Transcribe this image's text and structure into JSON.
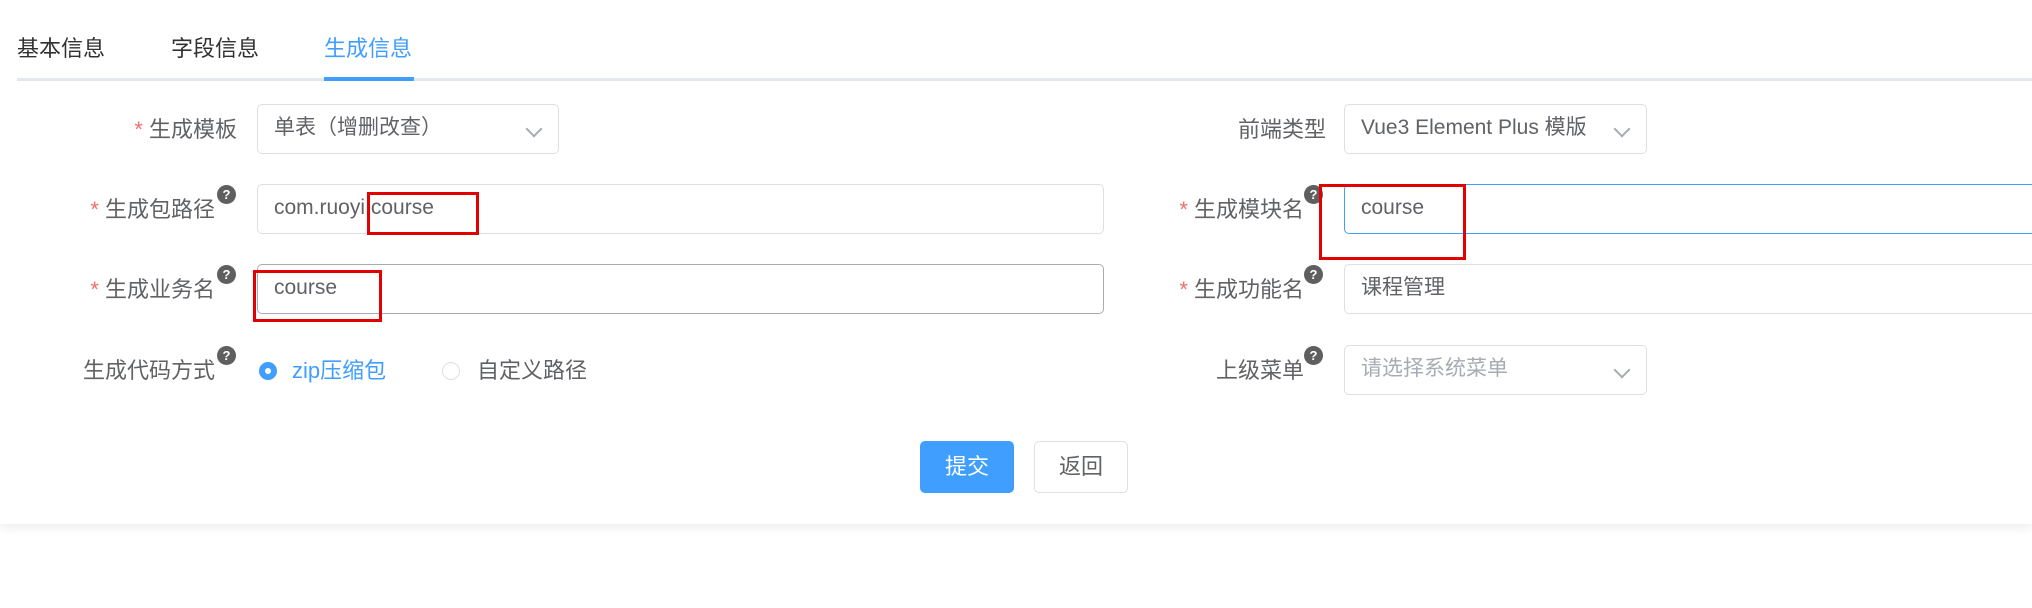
{
  "tabs": [
    {
      "label": "基本信息"
    },
    {
      "label": "字段信息"
    },
    {
      "label": "生成信息",
      "active": true
    }
  ],
  "form": {
    "template": {
      "label": "生成模板",
      "required": true,
      "value": "单表（增删改查）"
    },
    "frontend_type": {
      "label": "前端类型",
      "required": false,
      "value": "Vue3 Element Plus 模版"
    },
    "package_path": {
      "label": "生成包路径",
      "required": true,
      "value": "com.ruoyi.course"
    },
    "module_name": {
      "label": "生成模块名",
      "required": true,
      "value": "course"
    },
    "business_name": {
      "label": "生成业务名",
      "required": true,
      "value": "course"
    },
    "function_name": {
      "label": "生成功能名",
      "required": true,
      "value": "课程管理"
    },
    "gen_type": {
      "label": "生成代码方式",
      "options": [
        {
          "label": "zip压缩包",
          "checked": true
        },
        {
          "label": "自定义路径",
          "checked": false
        }
      ]
    },
    "parent_menu": {
      "label": "上级菜单",
      "placeholder": "请选择系统菜单",
      "value": ""
    }
  },
  "help_glyph": "?",
  "required_mark": "*",
  "buttons": {
    "submit": "提交",
    "back": "返回"
  },
  "colors": {
    "accent": "#409eff",
    "required": "#f56c6c",
    "annotation": "#e30000"
  },
  "icons": [
    "help-icon",
    "chevron-down-icon",
    "radio-icon"
  ]
}
